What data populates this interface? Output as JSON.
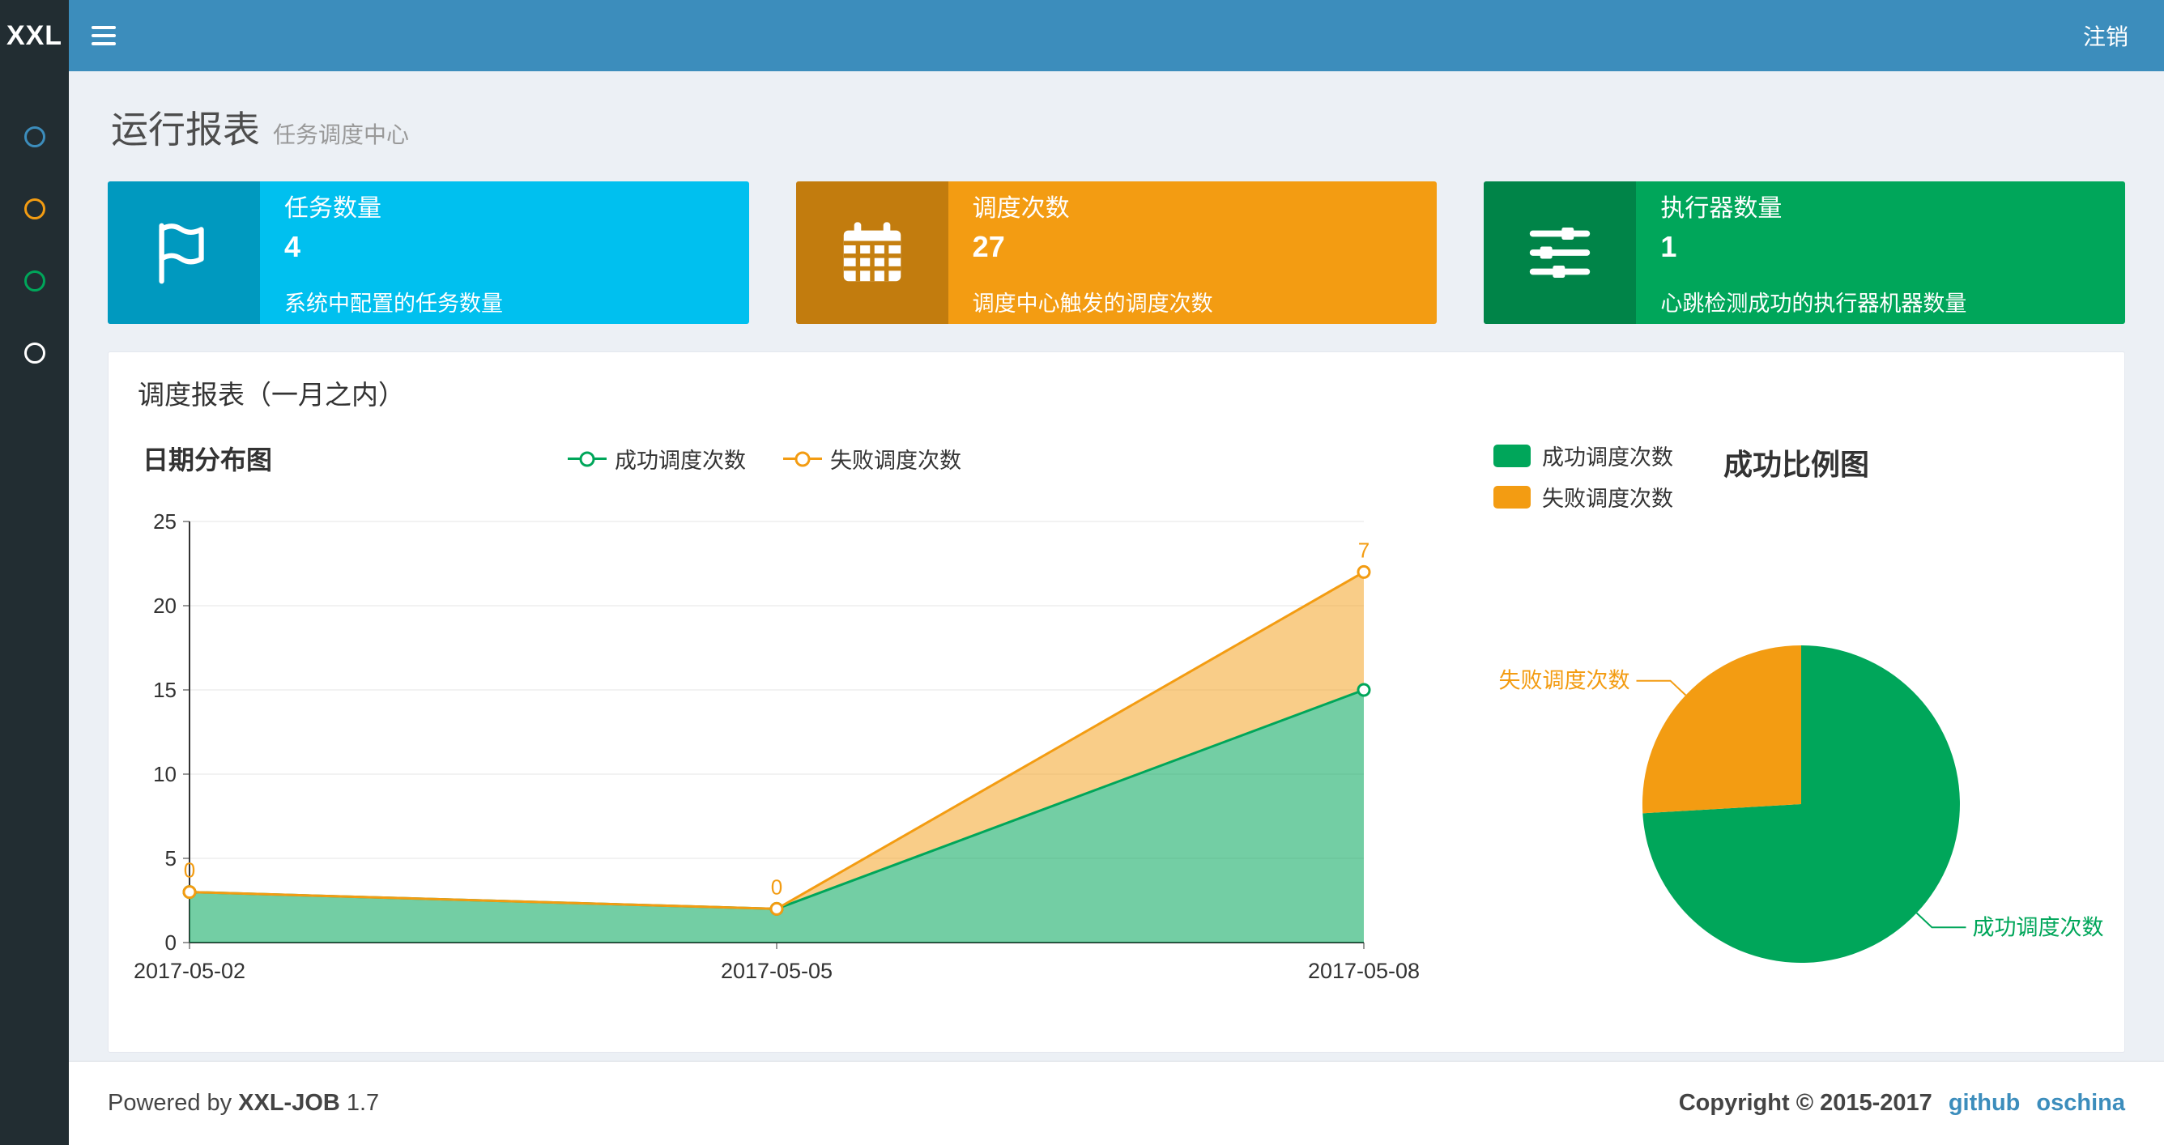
{
  "navbar": {
    "logo": "XXL",
    "logout": "注销"
  },
  "sidebar": {
    "dots": [
      {
        "name": "blue",
        "color": "#3c8dbc"
      },
      {
        "name": "orange",
        "color": "#f39c12"
      },
      {
        "name": "green",
        "color": "#00a65a"
      },
      {
        "name": "white",
        "color": "#ffffff"
      }
    ]
  },
  "page": {
    "title": "运行报表",
    "subtitle": "任务调度中心"
  },
  "info_boxes": [
    {
      "icon": "flag-icon",
      "label": "任务数量",
      "value": "4",
      "desc": "系统中配置的任务数量",
      "color": "#00c0ef"
    },
    {
      "icon": "calendar-icon",
      "label": "调度次数",
      "value": "27",
      "desc": "调度中心触发的调度次数",
      "color": "#f39c12"
    },
    {
      "icon": "sliders-icon",
      "label": "执行器数量",
      "value": "1",
      "desc": "心跳检测成功的执行器机器数量",
      "color": "#00a65a"
    }
  ],
  "panel": {
    "title": "调度报表（一月之内）"
  },
  "chart_data": [
    {
      "type": "area",
      "title": "日期分布图",
      "x": [
        "2017-05-02",
        "2017-05-05",
        "2017-05-08"
      ],
      "series": [
        {
          "name": "成功调度次数",
          "values": [
            3,
            2,
            15
          ],
          "color": "#00a65a"
        },
        {
          "name": "失败调度次数",
          "values": [
            0,
            0,
            7
          ],
          "color": "#f39c12",
          "stacked_on": "成功调度次数",
          "labels": [
            "0",
            "0",
            "7"
          ]
        }
      ],
      "ylim": [
        0,
        25
      ],
      "yticks": [
        0,
        5,
        10,
        15,
        20,
        25
      ],
      "grid": true,
      "legend_position": "top-center"
    },
    {
      "type": "pie",
      "title": "成功比例图",
      "slices": [
        {
          "name": "成功调度次数",
          "value": 20,
          "color": "#00a65a"
        },
        {
          "name": "失败调度次数",
          "value": 7,
          "color": "#f39c12"
        }
      ],
      "legend_position": "top-left"
    }
  ],
  "footer": {
    "powered_prefix": "Powered by",
    "product": "XXL-JOB",
    "version": "1.7",
    "copyright": "Copyright © 2015-2017",
    "links": [
      {
        "label": "github"
      },
      {
        "label": "oschina"
      }
    ]
  }
}
